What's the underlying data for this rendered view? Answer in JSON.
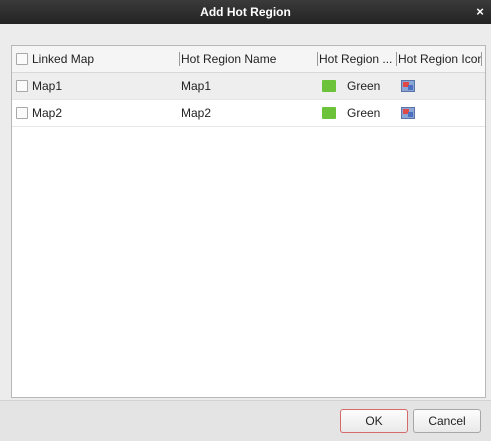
{
  "dialog": {
    "title": "Add Hot Region",
    "close_glyph": "×"
  },
  "table": {
    "columns": [
      {
        "label": "Linked Map"
      },
      {
        "label": "Hot Region Name"
      },
      {
        "label": "Hot Region ..."
      },
      {
        "label": "Hot Region Icon"
      }
    ],
    "rows": [
      {
        "linked_map": "Map1",
        "name": "Map1",
        "color_label": "Green",
        "color_hex": "#6cc33a",
        "icon": "map-region-icon",
        "checked": false
      },
      {
        "linked_map": "Map2",
        "name": "Map2",
        "color_label": "Green",
        "color_hex": "#6cc33a",
        "icon": "map-region-icon",
        "checked": false
      }
    ]
  },
  "buttons": {
    "ok_label": "OK",
    "cancel_label": "Cancel"
  },
  "colors": {
    "titlebar": "#2b2b2b",
    "ok_border": "#d46a6a",
    "green": "#6cc33a"
  }
}
